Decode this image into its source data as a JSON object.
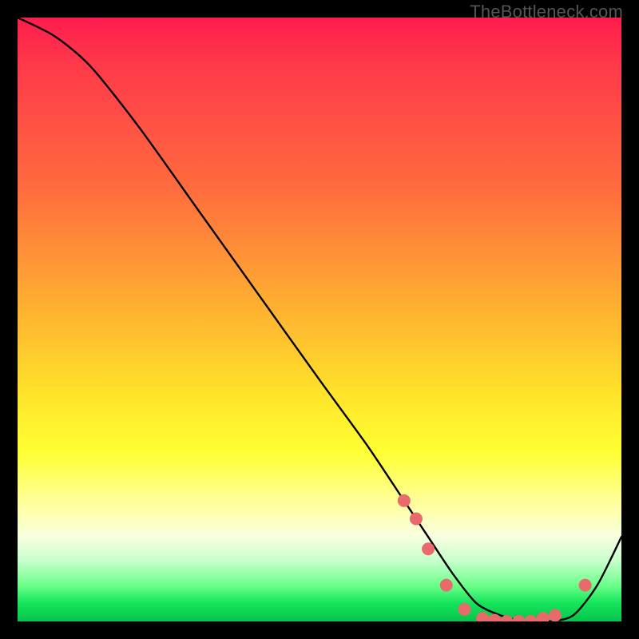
{
  "watermark_text": "TheBottleneck.com",
  "chart_data": {
    "type": "line",
    "title": "",
    "xlabel": "",
    "ylabel": "",
    "xlim": [
      0,
      100
    ],
    "ylim": [
      0,
      100
    ],
    "grid": false,
    "legend": false,
    "series": [
      {
        "name": "curve",
        "x": [
          0,
          6,
          12,
          20,
          30,
          40,
          50,
          58,
          64,
          68,
          72,
          76,
          80,
          84,
          88,
          92,
          96,
          100
        ],
        "values": [
          100,
          97,
          92,
          82,
          68,
          54,
          40,
          29,
          20,
          14,
          8,
          3,
          1,
          0,
          0,
          1,
          6,
          14
        ]
      }
    ],
    "dot_color": "#e86a6a",
    "dot_radius": 8,
    "highlighted_points": [
      {
        "x": 64,
        "y": 20
      },
      {
        "x": 66,
        "y": 17
      },
      {
        "x": 68,
        "y": 12
      },
      {
        "x": 71,
        "y": 6
      },
      {
        "x": 74,
        "y": 2
      },
      {
        "x": 77,
        "y": 0.5
      },
      {
        "x": 79,
        "y": 0.2
      },
      {
        "x": 81,
        "y": 0
      },
      {
        "x": 83,
        "y": 0
      },
      {
        "x": 85,
        "y": 0
      },
      {
        "x": 87,
        "y": 0.5
      },
      {
        "x": 89,
        "y": 1
      },
      {
        "x": 94,
        "y": 6
      }
    ]
  }
}
